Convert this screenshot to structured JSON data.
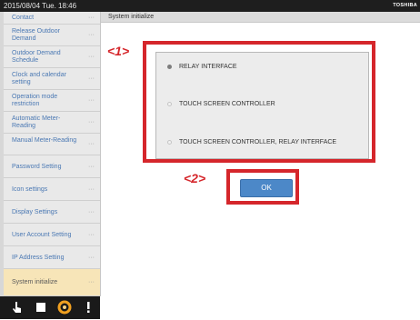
{
  "status_bar": {
    "datetime": "2015/08/04  Tue.  18:46",
    "brand": "TOSHIBA"
  },
  "header": {
    "title": "System initialize"
  },
  "sidebar": {
    "items": [
      {
        "label": "Contact"
      },
      {
        "label": "Release Outdoor Demand"
      },
      {
        "label": "Outdoor Demand Schedule"
      },
      {
        "label": "Clock and calendar setting"
      },
      {
        "label": "Operation mode restriction"
      },
      {
        "label": "Automatic Meter-Reading"
      },
      {
        "label": "Manual Meter-Reading"
      },
      {
        "label": "Password Setting"
      },
      {
        "label": "Icon settings"
      },
      {
        "label": "Display Settings"
      },
      {
        "label": "User Account Setting"
      },
      {
        "label": "IP Address Setting"
      },
      {
        "label": "System initialize",
        "selected": true
      }
    ],
    "more_glyph": "···"
  },
  "options": [
    {
      "label": "RELAY INTERFACE",
      "selected": true
    },
    {
      "label": "TOUCH SCREEN CONTROLLER",
      "selected": false
    },
    {
      "label": "TOUCH SCREEN CONTROLLER, RELAY INTERFACE",
      "selected": false
    }
  ],
  "ok_button": {
    "label": "OK"
  },
  "annotations": {
    "callout_1": "<1>",
    "callout_2": "<2>"
  },
  "bottom_icons": [
    "hand-pointer-icon",
    "stop-icon",
    "power-ring-icon",
    "alert-icon"
  ],
  "colors": {
    "accent": "#d5262b",
    "button": "#4c88c8",
    "selected_item": "#f7e5b8",
    "link_text": "#4a78b3"
  }
}
